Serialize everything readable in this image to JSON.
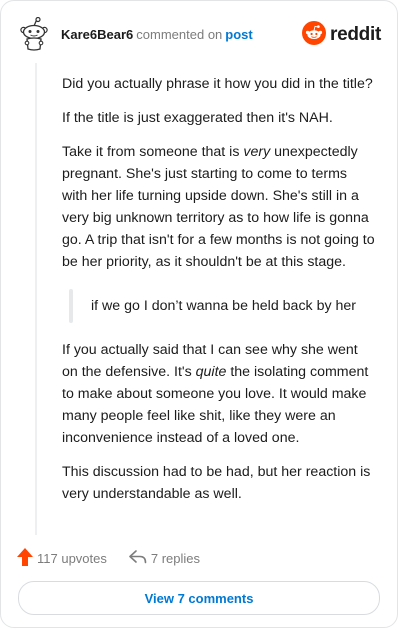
{
  "header": {
    "username": "Kare6Bear6",
    "action_text": "commented on",
    "post_link": "post",
    "brand": "reddit",
    "brand_color": "#ff4500",
    "icons": [
      "snoo-avatar-icon",
      "reddit-logo-icon"
    ]
  },
  "comment": {
    "paragraphs": [
      {
        "text": "Did you actually phrase it how you did in the title?"
      },
      {
        "text": "If the title is just exaggerated then it's NAH."
      },
      {
        "before": "Take it from someone that is ",
        "emph": "very",
        "after": " unexpectedly pregnant. She's just starting to come to terms with her life turning upside down. She's still in a very big unknown territory as to how life is gonna go. A trip that isn't for a few months is not going to be her priority, as it shouldn't be at this stage."
      }
    ],
    "quote": "if we go I don’t wanna be held back by her",
    "paragraphs_after": [
      {
        "before": "If you actually said that I can see why she went on the defensive. It's ",
        "emph": "quite",
        "after": " the isolating comment to make about someone you love. It would make many people feel like shit, like they were an inconvenience instead of a loved one."
      },
      {
        "text": "This discussion had to be had, but her reaction is very understandable as well."
      }
    ]
  },
  "footer": {
    "upvotes": "117 upvotes",
    "replies": "7 replies",
    "view_button": "View 7 comments",
    "upvote_color": "#ff4500",
    "icons": [
      "upvote-arrow-icon",
      "reply-arrow-icon"
    ]
  }
}
